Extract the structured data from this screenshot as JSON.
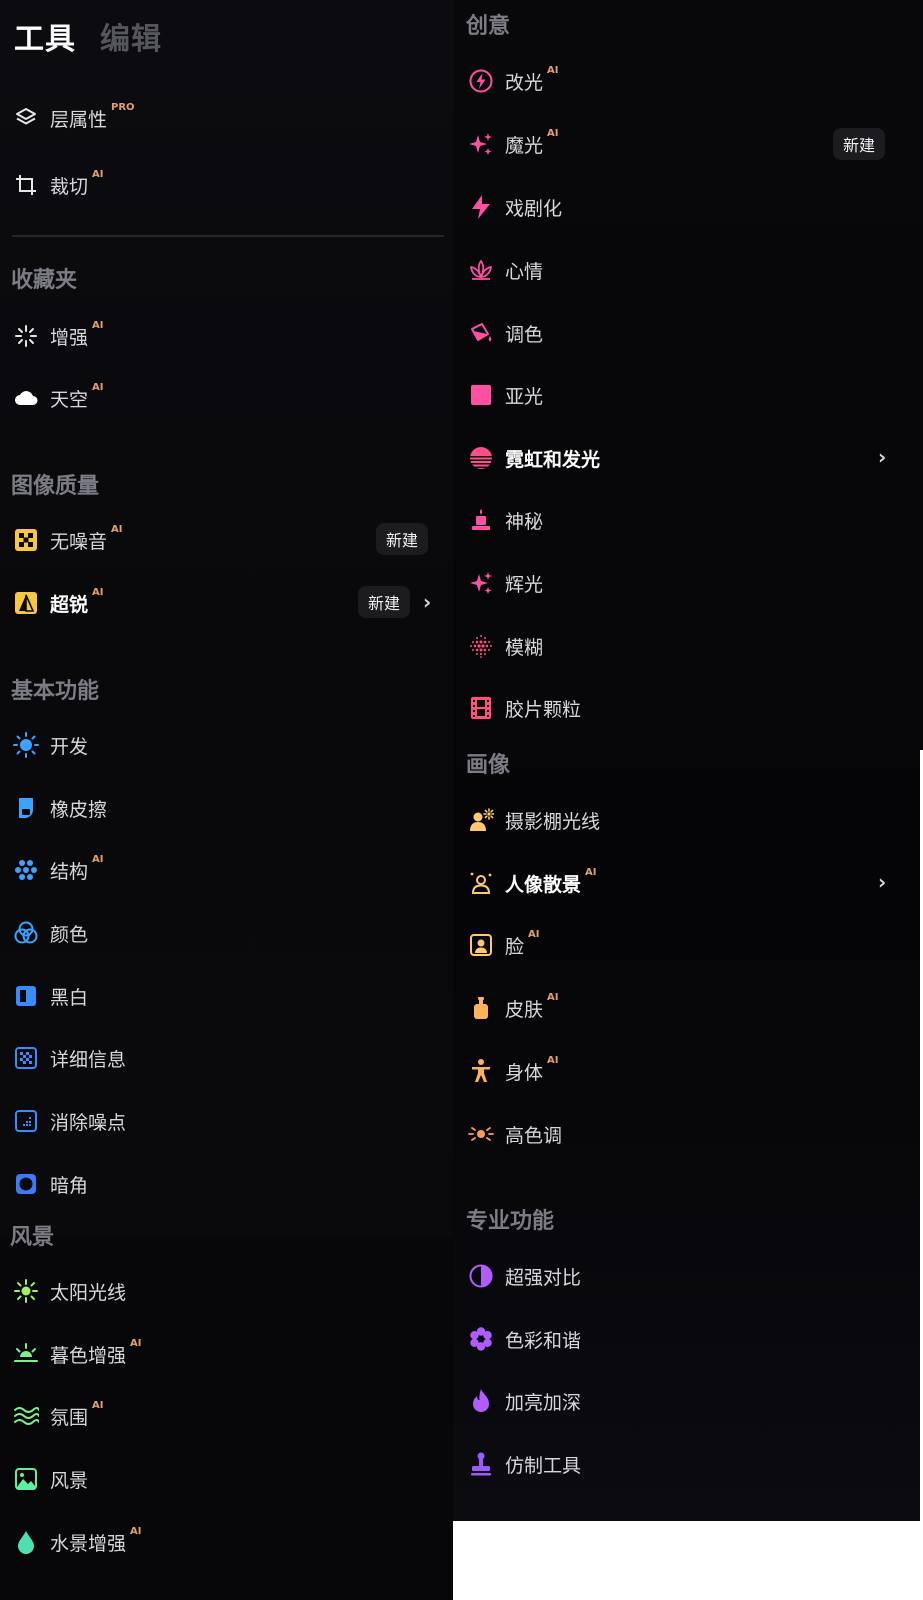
{
  "tabs": {
    "tools": "工具",
    "edit": "编辑"
  },
  "left": {
    "top_items": [
      {
        "label": "层属性",
        "badge": "PRO",
        "icon": "layers-icon"
      },
      {
        "label": "裁切",
        "badge": "AI",
        "icon": "crop-icon"
      }
    ],
    "favorites": {
      "title": "收藏夹",
      "items": [
        {
          "label": "增强",
          "badge": "AI",
          "icon": "sparkle-burst-icon"
        },
        {
          "label": "天空",
          "badge": "AI",
          "icon": "cloud-icon"
        }
      ]
    },
    "quality": {
      "title": "图像质量",
      "items": [
        {
          "label": "无噪音",
          "badge": "AI",
          "icon": "noiseless-icon",
          "new": "新建"
        },
        {
          "label": "超锐",
          "badge": "AI",
          "icon": "supersharp-icon",
          "new": "新建"
        }
      ]
    },
    "basic": {
      "title": "基本功能",
      "items": [
        {
          "label": "开发",
          "icon": "sun-icon"
        },
        {
          "label": "橡皮擦",
          "icon": "eraser-icon"
        },
        {
          "label": "结构",
          "badge": "AI",
          "icon": "structure-dots-icon"
        },
        {
          "label": "颜色",
          "icon": "color-circles-icon"
        },
        {
          "label": "黑白",
          "icon": "black-white-icon"
        },
        {
          "label": "详细信息",
          "icon": "details-grid-icon"
        },
        {
          "label": "消除噪点",
          "icon": "denoise-icon"
        },
        {
          "label": "暗角",
          "icon": "vignette-icon"
        }
      ]
    },
    "landscape": {
      "title": "风景",
      "items": [
        {
          "label": "太阳光线",
          "icon": "sunrays-icon"
        },
        {
          "label": "暮色增强",
          "badge": "AI",
          "icon": "sunset-icon"
        },
        {
          "label": "氛围",
          "badge": "AI",
          "icon": "waves-icon"
        },
        {
          "label": "风景",
          "icon": "landscape-image-icon"
        },
        {
          "label": "水景增强",
          "badge": "AI",
          "icon": "water-drop-icon"
        }
      ]
    }
  },
  "right": {
    "creative": {
      "title": "创意",
      "items": [
        {
          "label": "改光",
          "badge": "AI",
          "icon": "relight-icon"
        },
        {
          "label": "魔光",
          "badge": "AI",
          "icon": "magic-light-icon",
          "new": "新建"
        },
        {
          "label": "戏剧化",
          "icon": "dramatic-bolt-icon"
        },
        {
          "label": "心情",
          "icon": "lotus-icon"
        },
        {
          "label": "调色",
          "icon": "paint-bucket-icon"
        },
        {
          "label": "亚光",
          "icon": "matte-square-icon"
        },
        {
          "label": "霓虹和发光",
          "icon": "neon-icon"
        },
        {
          "label": "神秘",
          "icon": "mystic-icon"
        },
        {
          "label": "辉光",
          "icon": "glow-sparkle-icon"
        },
        {
          "label": "模糊",
          "icon": "blur-dots-icon"
        },
        {
          "label": "胶片颗粒",
          "icon": "film-grain-icon"
        }
      ]
    },
    "portrait": {
      "title": "画像",
      "items": [
        {
          "label": "摄影棚光线",
          "icon": "studio-light-icon"
        },
        {
          "label": "人像散景",
          "badge": "AI",
          "icon": "portrait-bokeh-icon"
        },
        {
          "label": "脸",
          "badge": "AI",
          "icon": "face-icon"
        },
        {
          "label": "皮肤",
          "badge": "AI",
          "icon": "skin-bottle-icon"
        },
        {
          "label": "身体",
          "badge": "AI",
          "icon": "body-icon"
        },
        {
          "label": "高色调",
          "icon": "high-key-icon"
        }
      ]
    },
    "pro": {
      "title": "专业功能",
      "items": [
        {
          "label": "超强对比",
          "icon": "contrast-icon"
        },
        {
          "label": "色彩和谐",
          "icon": "harmony-flower-icon"
        },
        {
          "label": "加亮加深",
          "icon": "dodge-burn-flame-icon"
        },
        {
          "label": "仿制工具",
          "icon": "clone-stamp-icon"
        }
      ]
    }
  },
  "colors": {
    "badge": "#e3a06c",
    "pink": "#ff4fa3",
    "yellow": "#f7c744",
    "blue": "#3aa3ff",
    "green": "#7cf08a",
    "orange": "#ffb15c",
    "purple": "#b15cff"
  }
}
